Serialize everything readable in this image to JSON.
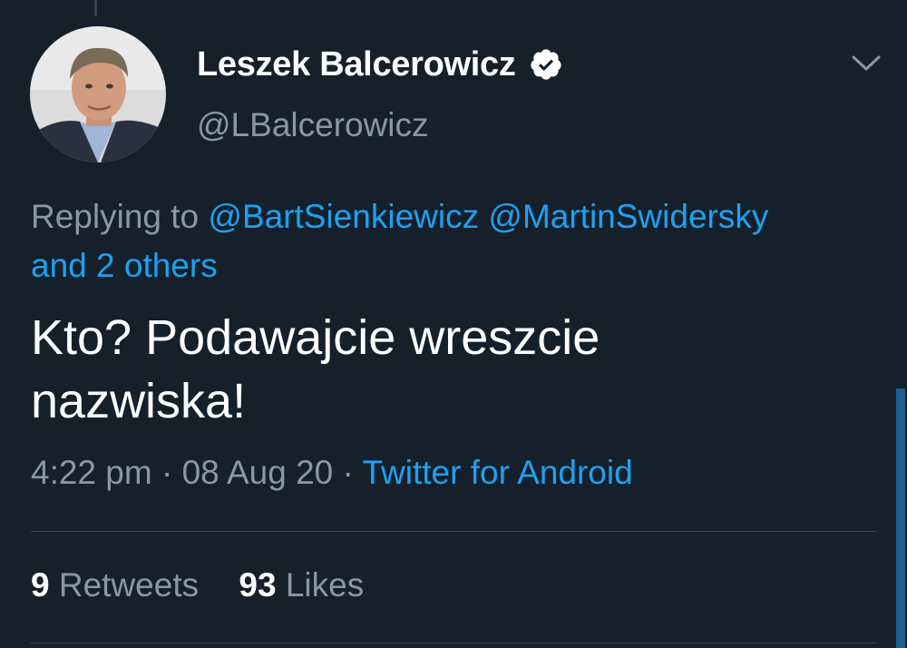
{
  "tweet": {
    "display_name": "Leszek Balcerowicz",
    "handle": "@LBalcerowicz",
    "reply": {
      "prefix": "Replying to",
      "mentions": [
        "@BartSienkiewicz",
        "@MartinSwidersky"
      ],
      "others": "and 2 others"
    },
    "text_line1": "Kto? Podawajcie wreszcie",
    "text_line2": "nazwiska!",
    "time": "4:22 pm",
    "separator": "·",
    "date": "08 Aug 20",
    "source": "Twitter for Android",
    "stats": {
      "retweets_count": "9",
      "retweets_label": "Retweets",
      "likes_count": "93",
      "likes_label": "Likes"
    }
  },
  "icons": {
    "verified": "verified-badge-icon",
    "menu": "chevron-down-icon"
  },
  "colors": {
    "background": "#15202b",
    "primary_text": "#ffffff",
    "secondary_text": "#8899a6",
    "accent": "#1da1f2",
    "divider": "#38444d"
  }
}
